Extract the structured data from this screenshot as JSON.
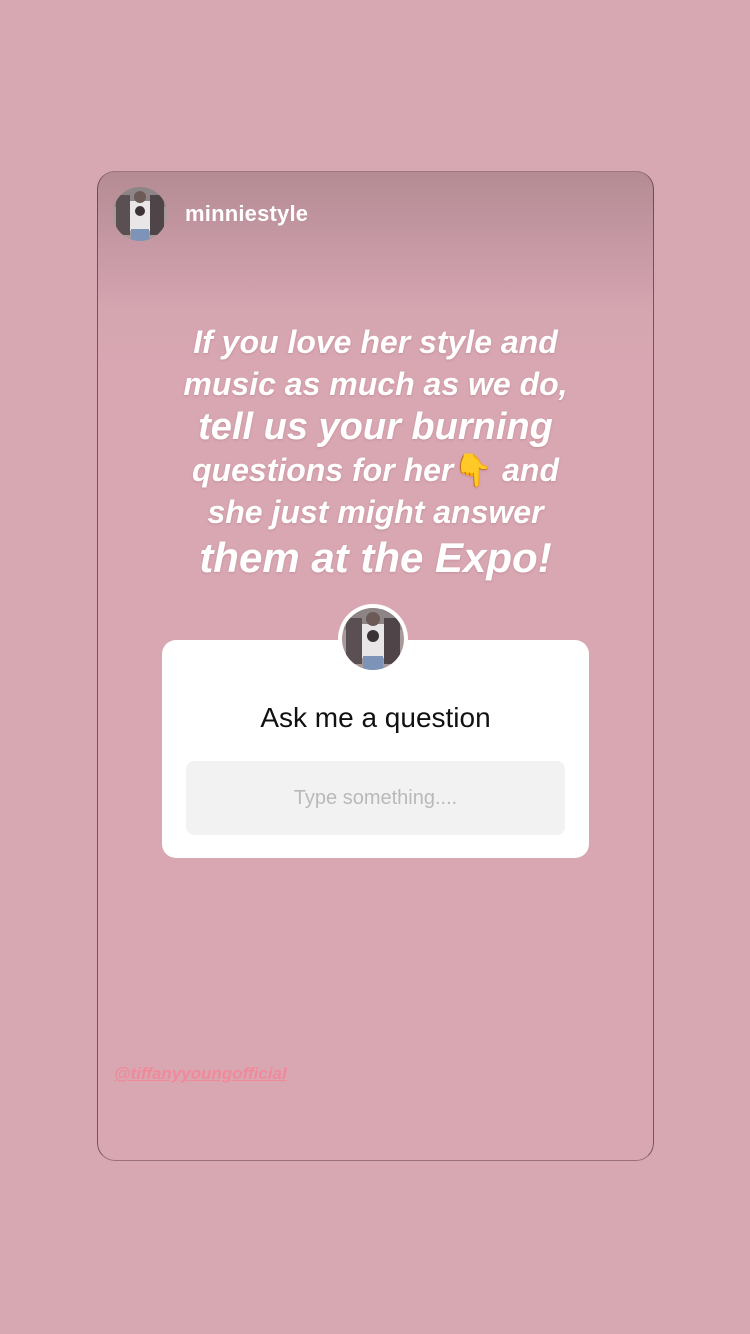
{
  "story": {
    "username": "minniestyle",
    "caption": {
      "line1": "If you love her style and",
      "line2": "music as much as we do,",
      "line3": "tell us your burning",
      "line4_before": "questions for her",
      "line4_emoji": "👇",
      "line4_after": " and",
      "line5": "she just might answer",
      "line6": "them at the Expo!"
    },
    "question_sticker": {
      "title": "Ask me a question",
      "placeholder": "Type something...."
    },
    "mention": "@tiffanyyoungofficial"
  },
  "icons": {
    "avatar": "profile-photo",
    "pointing": "backhand-index-pointing-down"
  },
  "colors": {
    "background": "#d7a7b2",
    "card_text": "#ffffff",
    "mention": "#f08a9b",
    "input_bg": "#f2f2f2"
  }
}
